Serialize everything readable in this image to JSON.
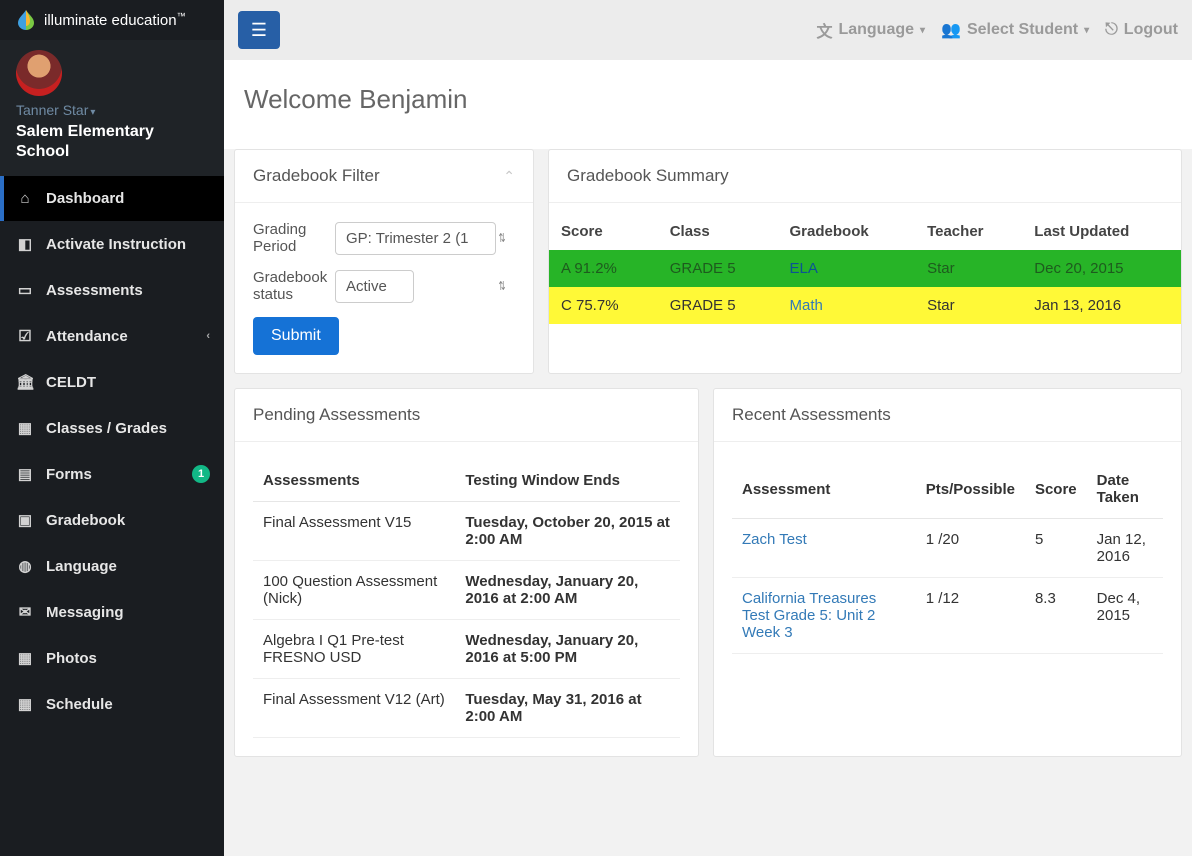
{
  "brand": {
    "name": "illuminate education",
    "tm": "™"
  },
  "user": {
    "display_name": "Tanner Star",
    "school": "Salem Elementary School"
  },
  "sidebar": {
    "items": [
      {
        "label": "Dashboard",
        "icon": "⌂",
        "active": true
      },
      {
        "label": "Activate Instruction",
        "icon": "◧"
      },
      {
        "label": "Assessments",
        "icon": "▭"
      },
      {
        "label": "Attendance",
        "icon": "☑",
        "chevron": true
      },
      {
        "label": "CELDT",
        "icon": "🏛"
      },
      {
        "label": "Classes / Grades",
        "icon": "▦"
      },
      {
        "label": "Forms",
        "icon": "▤",
        "badge": "1"
      },
      {
        "label": "Gradebook",
        "icon": "▣"
      },
      {
        "label": "Language",
        "icon": "◍"
      },
      {
        "label": "Messaging",
        "icon": "✉"
      },
      {
        "label": "Photos",
        "icon": "▦"
      },
      {
        "label": "Schedule",
        "icon": "▦"
      }
    ]
  },
  "topbar": {
    "language": "Language",
    "select_student": "Select Student",
    "logout": "Logout"
  },
  "page": {
    "welcome": "Welcome Benjamin"
  },
  "filter": {
    "title": "Gradebook Filter",
    "grading_period_label": "Grading Period",
    "grading_period_value": "GP: Trimester 2 (1",
    "status_label": "Gradebook status",
    "status_value": "Active",
    "submit": "Submit"
  },
  "summary": {
    "title": "Gradebook Summary",
    "headers": {
      "score": "Score",
      "class": "Class",
      "gradebook": "Gradebook",
      "teacher": "Teacher",
      "updated": "Last Updated"
    },
    "rows": [
      {
        "score": "A 91.2%",
        "class": "GRADE 5",
        "gradebook": "ELA",
        "teacher": "Star",
        "updated": "Dec 20, 2015",
        "color": "green"
      },
      {
        "score": "C 75.7%",
        "class": "GRADE 5",
        "gradebook": "Math",
        "teacher": "Star",
        "updated": "Jan 13, 2016",
        "color": "yellow"
      }
    ]
  },
  "pending": {
    "title": "Pending Assessments",
    "headers": {
      "name": "Assessments",
      "ends": "Testing Window Ends"
    },
    "rows": [
      {
        "name": "Final Assessment V15",
        "ends": "Tuesday, October 20, 2015 at 2:00 AM"
      },
      {
        "name": "100 Question Assessment (Nick)",
        "ends": "Wednesday, January 20, 2016 at 2:00 AM"
      },
      {
        "name": "Algebra I Q1 Pre-test FRESNO USD",
        "ends": "Wednesday, January 20, 2016 at 5:00 PM"
      },
      {
        "name": "Final Assessment V12 (Art)",
        "ends": "Tuesday, May 31, 2016 at 2:00 AM"
      }
    ]
  },
  "recent": {
    "title": "Recent Assessments",
    "headers": {
      "name": "Assessment",
      "pts": "Pts/Possible",
      "score": "Score",
      "date": "Date Taken"
    },
    "rows": [
      {
        "name": "Zach Test",
        "pts": "1 /20",
        "score": "5",
        "date": "Jan 12, 2016"
      },
      {
        "name": "California Treasures Test Grade 5: Unit 2 Week 3",
        "pts": "1 /12",
        "score": "8.3",
        "date": "Dec 4, 2015"
      }
    ]
  }
}
